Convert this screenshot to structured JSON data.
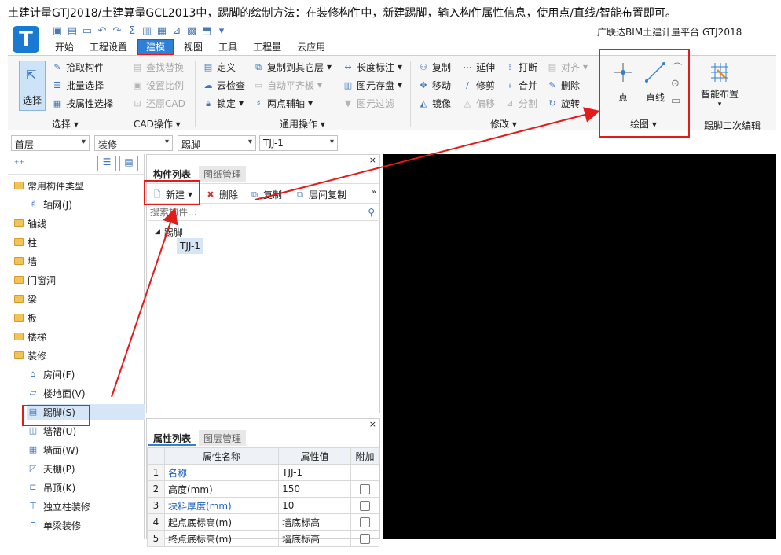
{
  "caption": "土建计量GTJ2018/土建算量GCL2013中，踢脚的绘制方法：在装修构件中，新建踢脚，输入构件属性信息，使用点/直线/智能布置即可。",
  "app": {
    "logo": "T",
    "brand": "广联达BIM土建计量平台 GTJ2018"
  },
  "tabs": [
    "开始",
    "工程设置",
    "建模",
    "视图",
    "工具",
    "工程量",
    "云应用"
  ],
  "ribbon": {
    "select_group": {
      "label": "选择",
      "big": "选择",
      "items": [
        "拾取构件",
        "批量选择",
        "按属性选择"
      ]
    },
    "cad_group": {
      "label": "CAD操作",
      "items": [
        "查找替换",
        "设置比例",
        "还原CAD"
      ]
    },
    "common_group": {
      "label": "通用操作",
      "col1": [
        "定义",
        "云检查",
        "锁定"
      ],
      "col2": [
        "复制到其它层",
        "自动平齐板",
        "两点辅轴"
      ],
      "col3": [
        "长度标注",
        "图元存盘",
        "图元过滤"
      ]
    },
    "modify_group": {
      "label": "修改",
      "col1": [
        "复制",
        "移动",
        "镜像"
      ],
      "col2": [
        "延伸",
        "修剪",
        "偏移"
      ],
      "col3": [
        "打断",
        "合并",
        "分割"
      ],
      "col4": [
        "对齐",
        "删除",
        "旋转"
      ]
    },
    "draw_group": {
      "label": "绘图",
      "point": "点",
      "line": "直线"
    },
    "smart_group": {
      "label": "踢脚二次编辑",
      "smart": "智能布置"
    }
  },
  "selectors": [
    "首层",
    "装修",
    "踢脚",
    "TJJ-1"
  ],
  "tree": {
    "items": [
      {
        "label": "常用构件类型",
        "type": "open"
      },
      {
        "label": "轴网(J)",
        "type": "sub"
      },
      {
        "label": "轴线",
        "type": "folder"
      },
      {
        "label": "柱",
        "type": "folder"
      },
      {
        "label": "墙",
        "type": "folder"
      },
      {
        "label": "门窗洞",
        "type": "folder"
      },
      {
        "label": "梁",
        "type": "folder"
      },
      {
        "label": "板",
        "type": "folder"
      },
      {
        "label": "楼梯",
        "type": "folder"
      },
      {
        "label": "装修",
        "type": "open"
      },
      {
        "label": "房间(F)",
        "type": "sub"
      },
      {
        "label": "楼地面(V)",
        "type": "sub"
      },
      {
        "label": "踢脚(S)",
        "type": "sub"
      },
      {
        "label": "墙裙(U)",
        "type": "sub"
      },
      {
        "label": "墙面(W)",
        "type": "sub"
      },
      {
        "label": "天棚(P)",
        "type": "sub"
      },
      {
        "label": "吊顶(K)",
        "type": "sub"
      },
      {
        "label": "独立柱装修",
        "type": "sub"
      },
      {
        "label": "单梁装修",
        "type": "sub"
      }
    ]
  },
  "component_panel": {
    "tabs": [
      "构件列表",
      "图纸管理"
    ],
    "toolbar": {
      "new": "新建",
      "delete": "删除",
      "copy": "复制",
      "layer_copy": "层间复制"
    },
    "search_placeholder": "搜索构件...",
    "tree_root": "踢脚",
    "tree_child": "TJJ-1"
  },
  "property_panel": {
    "tabs": [
      "属性列表",
      "图层管理"
    ],
    "headers": [
      "属性名称",
      "属性值",
      "附加"
    ],
    "rows": [
      {
        "n": "1",
        "name": "名称",
        "value": "TJJ-1",
        "blue": true,
        "check": false
      },
      {
        "n": "2",
        "name": "高度(mm)",
        "value": "150",
        "blue": false,
        "check": true
      },
      {
        "n": "3",
        "name": "块料厚度(mm)",
        "value": "10",
        "blue": true,
        "check": true
      },
      {
        "n": "4",
        "name": "起点底标高(m)",
        "value": "墙底标高",
        "blue": false,
        "check": true
      },
      {
        "n": "5",
        "name": "终点底标高(m)",
        "value": "墙底标高",
        "blue": false,
        "check": true
      }
    ]
  },
  "annotation_colors": {
    "red": "#e31b1b",
    "accent": "#2e7fd6"
  }
}
